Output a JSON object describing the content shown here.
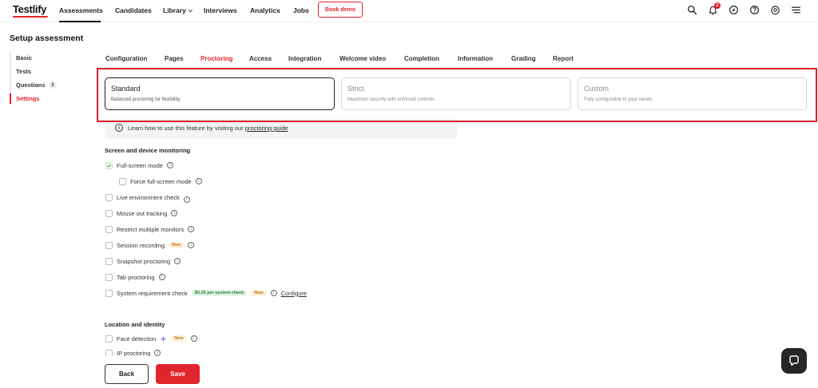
{
  "app": {
    "logo": "Testlify"
  },
  "nav": {
    "items": [
      {
        "label": "Assessments"
      },
      {
        "label": "Candidates"
      },
      {
        "label": "Library"
      },
      {
        "label": "Interviews"
      },
      {
        "label": "Analytics"
      },
      {
        "label": "Jobs"
      }
    ],
    "book_demo": "Book demo",
    "notification_count": "2",
    "icons": [
      "search-icon",
      "bell-icon",
      "compass-icon",
      "help-icon",
      "gear-icon",
      "menu-icon"
    ]
  },
  "page": {
    "title": "Setup assessment"
  },
  "sidebar": {
    "items": [
      {
        "label": "Basic"
      },
      {
        "label": "Tests"
      },
      {
        "label": "Questions",
        "count": "3"
      },
      {
        "label": "Settings"
      }
    ]
  },
  "tabs": [
    {
      "label": "Configuration"
    },
    {
      "label": "Pages"
    },
    {
      "label": "Proctoring"
    },
    {
      "label": "Access"
    },
    {
      "label": "Integration"
    },
    {
      "label": "Welcome video"
    },
    {
      "label": "Completion"
    },
    {
      "label": "Information"
    },
    {
      "label": "Grading"
    },
    {
      "label": "Report"
    }
  ],
  "modes": [
    {
      "title": "Standard",
      "desc": "Balanced proctoring for flexibility."
    },
    {
      "title": "Strict",
      "desc": "Maximum security with enforced controls."
    },
    {
      "title": "Custom",
      "desc": "Fully configurable to your needs."
    }
  ],
  "info": {
    "text": "Learn how to use this feature by visiting our ",
    "link": "proctoring guide"
  },
  "screen_section": {
    "title": "Screen and device monitoring",
    "items": [
      {
        "label": "Full-screen mode"
      },
      {
        "label": "Force full-screen mode"
      },
      {
        "label": "Live environment check"
      },
      {
        "label": "Mouse out tracking"
      },
      {
        "label": "Restrict multiple monitors"
      },
      {
        "label": "Session recording",
        "badge": "New"
      },
      {
        "label": "Snapshot proctoring"
      },
      {
        "label": "Tab proctoring"
      },
      {
        "label": "System requirement check",
        "price": "$0.25 per system check",
        "badge": "New",
        "link": "Configure"
      }
    ]
  },
  "location_section": {
    "title": "Location and identity",
    "items": [
      {
        "label": "Face detection",
        "badge": "New"
      },
      {
        "label": "IP proctoring"
      }
    ]
  },
  "actions": {
    "back": "Back",
    "save": "Save"
  },
  "colors": {
    "accent": "#e0252c",
    "text": "#1f1f1f",
    "highlight": "#d9202a"
  }
}
